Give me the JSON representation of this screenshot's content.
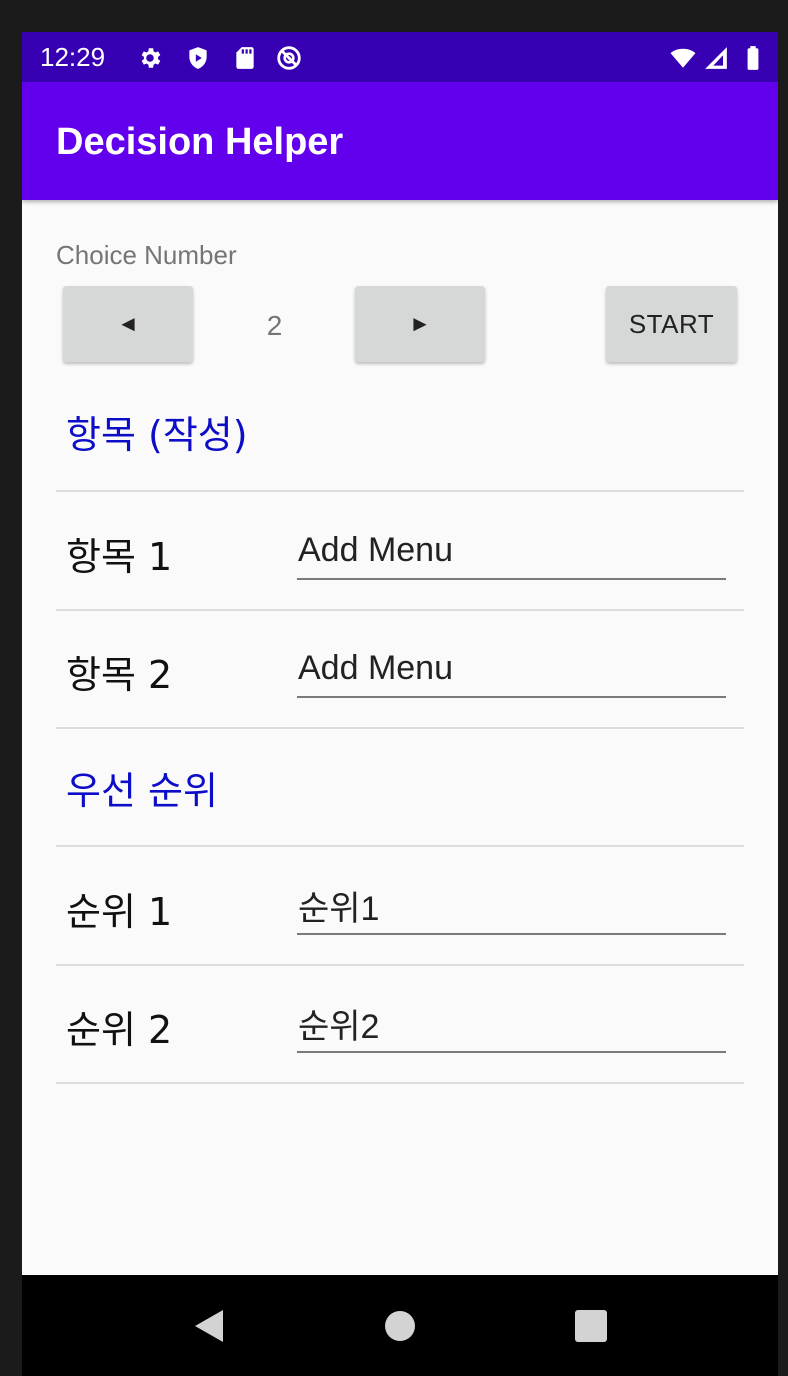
{
  "status_bar": {
    "time": "12:29",
    "left_icons": [
      "settings-icon",
      "shield-icon",
      "sd-card-icon",
      "do-not-disturb-icon"
    ],
    "right_icons": [
      "wifi-icon",
      "signal-icon",
      "battery-icon"
    ]
  },
  "app_bar": {
    "title": "Decision Helper"
  },
  "choice": {
    "label": "Choice Number",
    "prev_label": "◄",
    "value": "2",
    "next_label": "►",
    "start_label": "START"
  },
  "items_section": {
    "title": "항목 (작성)",
    "rows": [
      {
        "label": "항목 1",
        "placeholder": "Add Menu"
      },
      {
        "label": "항목 2",
        "placeholder": "Add Menu"
      }
    ]
  },
  "priority_section": {
    "title": "우선 순위",
    "rows": [
      {
        "label": "순위 1",
        "value": "순위1"
      },
      {
        "label": "순위 2",
        "value": "순위2"
      }
    ]
  },
  "nav_bar": {
    "icons": [
      "back-icon",
      "home-icon",
      "recents-icon"
    ]
  },
  "colors": {
    "status_bar": "#3700b3",
    "app_bar": "#6200ee",
    "section_title": "#0d0dc8",
    "button": "#d6d7d7"
  }
}
